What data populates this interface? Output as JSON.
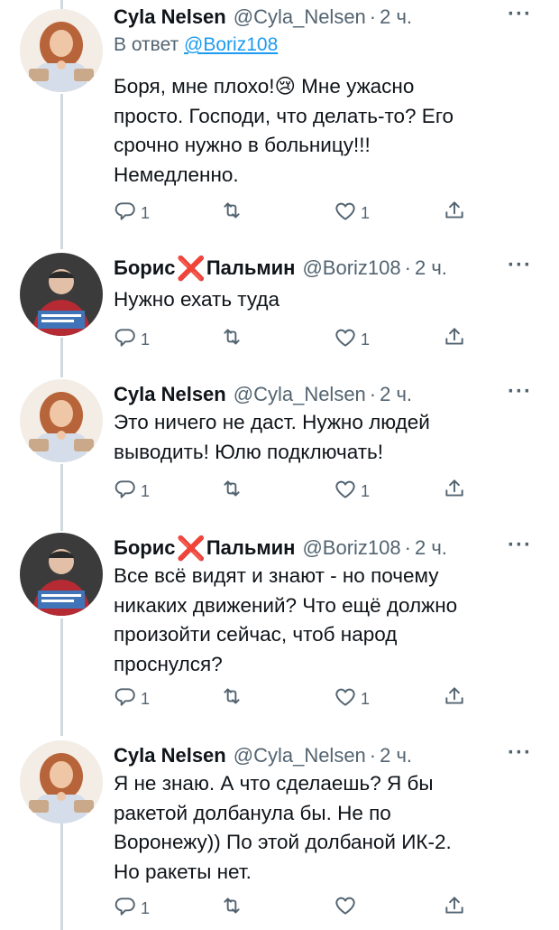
{
  "tweets": [
    {
      "author": "Cyla Nelsen",
      "handle": "@Cyla_Nelsen",
      "time": "2 ч.",
      "reply_to_prefix": "В ответ",
      "reply_to_handle": "@Boriz108",
      "text": "Боря, мне плохо!😢 Мне ужасно\nпросто. Господи, что делать-то? Его\nсрочно нужно в больницу!!!\nНемедленно.",
      "replies": "1",
      "retweets": "",
      "likes": "1",
      "avatar": "woman-avatar"
    },
    {
      "author_first": "Борис",
      "author_cross": "❌",
      "author_last": "Пальмин",
      "handle": "@Boriz108",
      "time": "2 ч.",
      "text": "Нужно ехать туда",
      "replies": "1",
      "retweets": "",
      "likes": "1",
      "avatar": "man-avatar"
    },
    {
      "author": "Cyla Nelsen",
      "handle": "@Cyla_Nelsen",
      "time": "2 ч.",
      "text": "Это ничего не даст. Нужно людей\nвыводить! Юлю подключать!",
      "replies": "1",
      "retweets": "",
      "likes": "1",
      "avatar": "woman-avatar"
    },
    {
      "author_first": "Борис",
      "author_cross": "❌",
      "author_last": "Пальмин",
      "handle": "@Boriz108",
      "time": "2 ч.",
      "text": "Все всё видят и знают - но почему\nникаких движений? Что ещё должно\nпроизойти сейчас, чтоб народ\nпроснулся?",
      "replies": "1",
      "retweets": "",
      "likes": "1",
      "avatar": "man-avatar"
    },
    {
      "author": "Cyla Nelsen",
      "handle": "@Cyla_Nelsen",
      "time": "2 ч.",
      "text": "Я не знаю. А что сделаешь? Я бы\nракетой долбанула бы. Не по\nВоронежу)) По этой долбаной ИК-2.\nНо ракеты нет.",
      "replies": "1",
      "retweets": "",
      "likes": "",
      "avatar": "woman-avatar"
    }
  ],
  "ui": {
    "dot": "·",
    "more": "···"
  },
  "icons": {
    "reply": "reply-icon",
    "retweet": "retweet-icon",
    "like": "heart-icon",
    "share": "share-icon"
  },
  "colors": {
    "link": "#1d9bf0",
    "muted": "#536471",
    "thread": "#cfd9de",
    "cross": "#e0245e"
  }
}
